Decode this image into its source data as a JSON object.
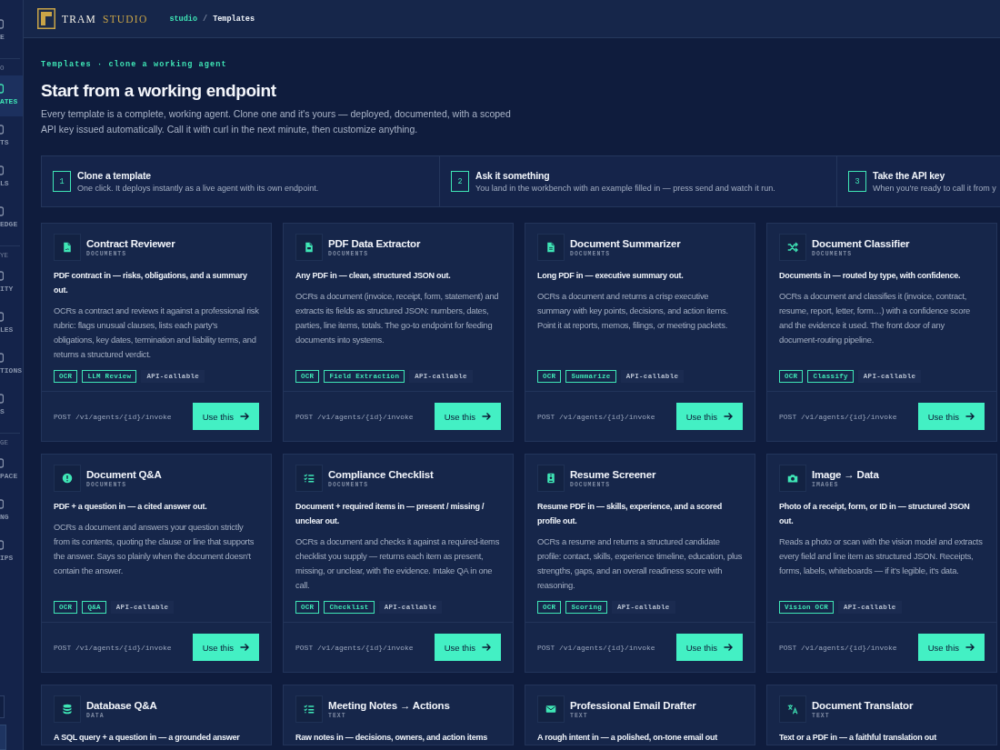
{
  "sidebar": {
    "groups": [
      {
        "items": [
          {
            "label": "E",
            "selected": false
          }
        ]
      },
      {
        "heading": "O",
        "items": [
          {
            "label": "ATES",
            "selected": true
          },
          {
            "label": "TS",
            "selected": false
          },
          {
            "label": "LS",
            "selected": false
          },
          {
            "label": "EDGE",
            "selected": false
          }
        ]
      },
      {
        "heading": "YE",
        "items": [
          {
            "label": "ITY",
            "selected": false
          },
          {
            "label": "LES",
            "selected": false
          },
          {
            "label": "TIONS",
            "selected": false
          },
          {
            "label": "S",
            "selected": false
          }
        ]
      },
      {
        "heading": "GE",
        "items": [
          {
            "label": "PACE",
            "selected": false
          },
          {
            "label": "NG",
            "selected": false
          },
          {
            "label": "IPS",
            "selected": false
          }
        ]
      }
    ]
  },
  "header": {
    "brand": {
      "name": "TRAM",
      "accent": "STUDIO"
    },
    "breadcrumb": {
      "separator": "/",
      "items": [
        {
          "label": "studio",
          "current": false
        },
        {
          "label": "Templates",
          "current": true
        }
      ]
    }
  },
  "page": {
    "eyebrow": "Templates · clone a working agent",
    "title": "Start from a working endpoint",
    "intro": "Every template is a complete, working agent. Clone one and it's yours — deployed, documented, with a scoped API key issued automatically. Call it with curl in the next minute, then customize anything."
  },
  "steps": [
    {
      "number": "1",
      "title": "Clone a template",
      "description": "One click. It deploys instantly as a live agent with its own endpoint."
    },
    {
      "number": "2",
      "title": "Ask it something",
      "description": "You land in the workbench with an example filled in — press send and watch it run."
    },
    {
      "number": "3",
      "title": "Take the API key",
      "description": "When you're ready to call it from y"
    }
  ],
  "templates": [
    {
      "title": "Contract Reviewer",
      "category": "DOCUMENTS",
      "summary": "PDF contract in — risks, obligations, and a summary out.",
      "description": "OCRs a contract and reviews it against a professional risk rubric: flags unusual clauses, lists each party's obligations, key dates, termination and liability terms, and returns a structured verdict.",
      "tags": [
        {
          "label": "OCR",
          "kind": "capability"
        },
        {
          "label": "LLM Review",
          "kind": "capability"
        },
        {
          "label": "API-callable",
          "kind": "plain"
        }
      ],
      "endpoint": "POST /v1/agents/{id}/invoke",
      "action": "Use this"
    },
    {
      "title": "PDF Data Extractor",
      "category": "DOCUMENTS",
      "summary": "Any PDF in — clean, structured JSON out.",
      "description": "OCRs a document (invoice, receipt, form, statement) and extracts its fields as structured JSON: numbers, dates, parties, line items, totals. The go-to endpoint for feeding documents into systems.",
      "tags": [
        {
          "label": "OCR",
          "kind": "capability"
        },
        {
          "label": "Field Extraction",
          "kind": "capability"
        },
        {
          "label": "API-callable",
          "kind": "plain"
        }
      ],
      "endpoint": "POST /v1/agents/{id}/invoke",
      "action": "Use this"
    },
    {
      "title": "Document Summarizer",
      "category": "DOCUMENTS",
      "summary": "Long PDF in — executive summary out.",
      "description": "OCRs a document and returns a crisp executive summary with key points, decisions, and action items. Point it at reports, memos, filings, or meeting packets.",
      "tags": [
        {
          "label": "OCR",
          "kind": "capability"
        },
        {
          "label": "Summarize",
          "kind": "capability"
        },
        {
          "label": "API-callable",
          "kind": "plain"
        }
      ],
      "endpoint": "POST /v1/agents/{id}/invoke",
      "action": "Use this"
    },
    {
      "title": "Document Classifier",
      "category": "DOCUMENTS",
      "summary": "Documents in — routed by type, with confidence.",
      "description": "OCRs a document and classifies it (invoice, contract, resume, report, letter, form…) with a confidence score and the evidence it used. The front door of any document-routing pipeline.",
      "tags": [
        {
          "label": "OCR",
          "kind": "capability"
        },
        {
          "label": "Classify",
          "kind": "capability"
        },
        {
          "label": "API-callable",
          "kind": "plain"
        }
      ],
      "endpoint": "POST /v1/agents/{id}/invoke",
      "action": "Use this"
    },
    {
      "title": "Document Q&A",
      "category": "DOCUMENTS",
      "summary": "PDF + a question in — a cited answer out.",
      "description": "OCRs a document and answers your question strictly from its contents, quoting the clause or line that supports the answer. Says so plainly when the document doesn't contain the answer.",
      "tags": [
        {
          "label": "OCR",
          "kind": "capability"
        },
        {
          "label": "Q&A",
          "kind": "capability"
        },
        {
          "label": "API-callable",
          "kind": "plain"
        }
      ],
      "endpoint": "POST /v1/agents/{id}/invoke",
      "action": "Use this"
    },
    {
      "title": "Compliance Checklist",
      "category": "DOCUMENTS",
      "summary": "Document + required items in — present / missing / unclear out.",
      "description": "OCRs a document and checks it against a required-items checklist you supply — returns each item as present, missing, or unclear, with the evidence. Intake QA in one call.",
      "tags": [
        {
          "label": "OCR",
          "kind": "capability"
        },
        {
          "label": "Checklist",
          "kind": "capability"
        },
        {
          "label": "API-callable",
          "kind": "plain"
        }
      ],
      "endpoint": "POST /v1/agents/{id}/invoke",
      "action": "Use this"
    },
    {
      "title": "Resume Screener",
      "category": "DOCUMENTS",
      "summary": "Resume PDF in — skills, experience, and a scored profile out.",
      "description": "OCRs a resume and returns a structured candidate profile: contact, skills, experience timeline, education, plus strengths, gaps, and an overall readiness score with reasoning.",
      "tags": [
        {
          "label": "OCR",
          "kind": "capability"
        },
        {
          "label": "Scoring",
          "kind": "capability"
        },
        {
          "label": "API-callable",
          "kind": "plain"
        }
      ],
      "endpoint": "POST /v1/agents/{id}/invoke",
      "action": "Use this"
    },
    {
      "title": "Image → Data",
      "category": "IMAGES",
      "summary": "Photo of a receipt, form, or ID in — structured JSON out.",
      "description": "Reads a photo or scan with the vision model and extracts every field and line item as structured JSON. Receipts, forms, labels, whiteboards — if it's legible, it's data.",
      "tags": [
        {
          "label": "Vision OCR",
          "kind": "capability"
        },
        {
          "label": "API-callable",
          "kind": "plain"
        }
      ],
      "endpoint": "POST /v1/agents/{id}/invoke",
      "action": "Use this"
    },
    {
      "title": "Database Q&A",
      "category": "DATA",
      "summary": "A SQL query + a question in — a grounded answer"
    },
    {
      "title": "Meeting Notes → Actions",
      "category": "TEXT",
      "summary": "Raw notes in — decisions, owners, and action items"
    },
    {
      "title": "Professional Email Drafter",
      "category": "TEXT",
      "summary": "A rough intent in — a polished, on-tone email out"
    },
    {
      "title": "Document Translator",
      "category": "TEXT",
      "summary": "Text or a PDF in — a faithful translation out"
    }
  ]
}
